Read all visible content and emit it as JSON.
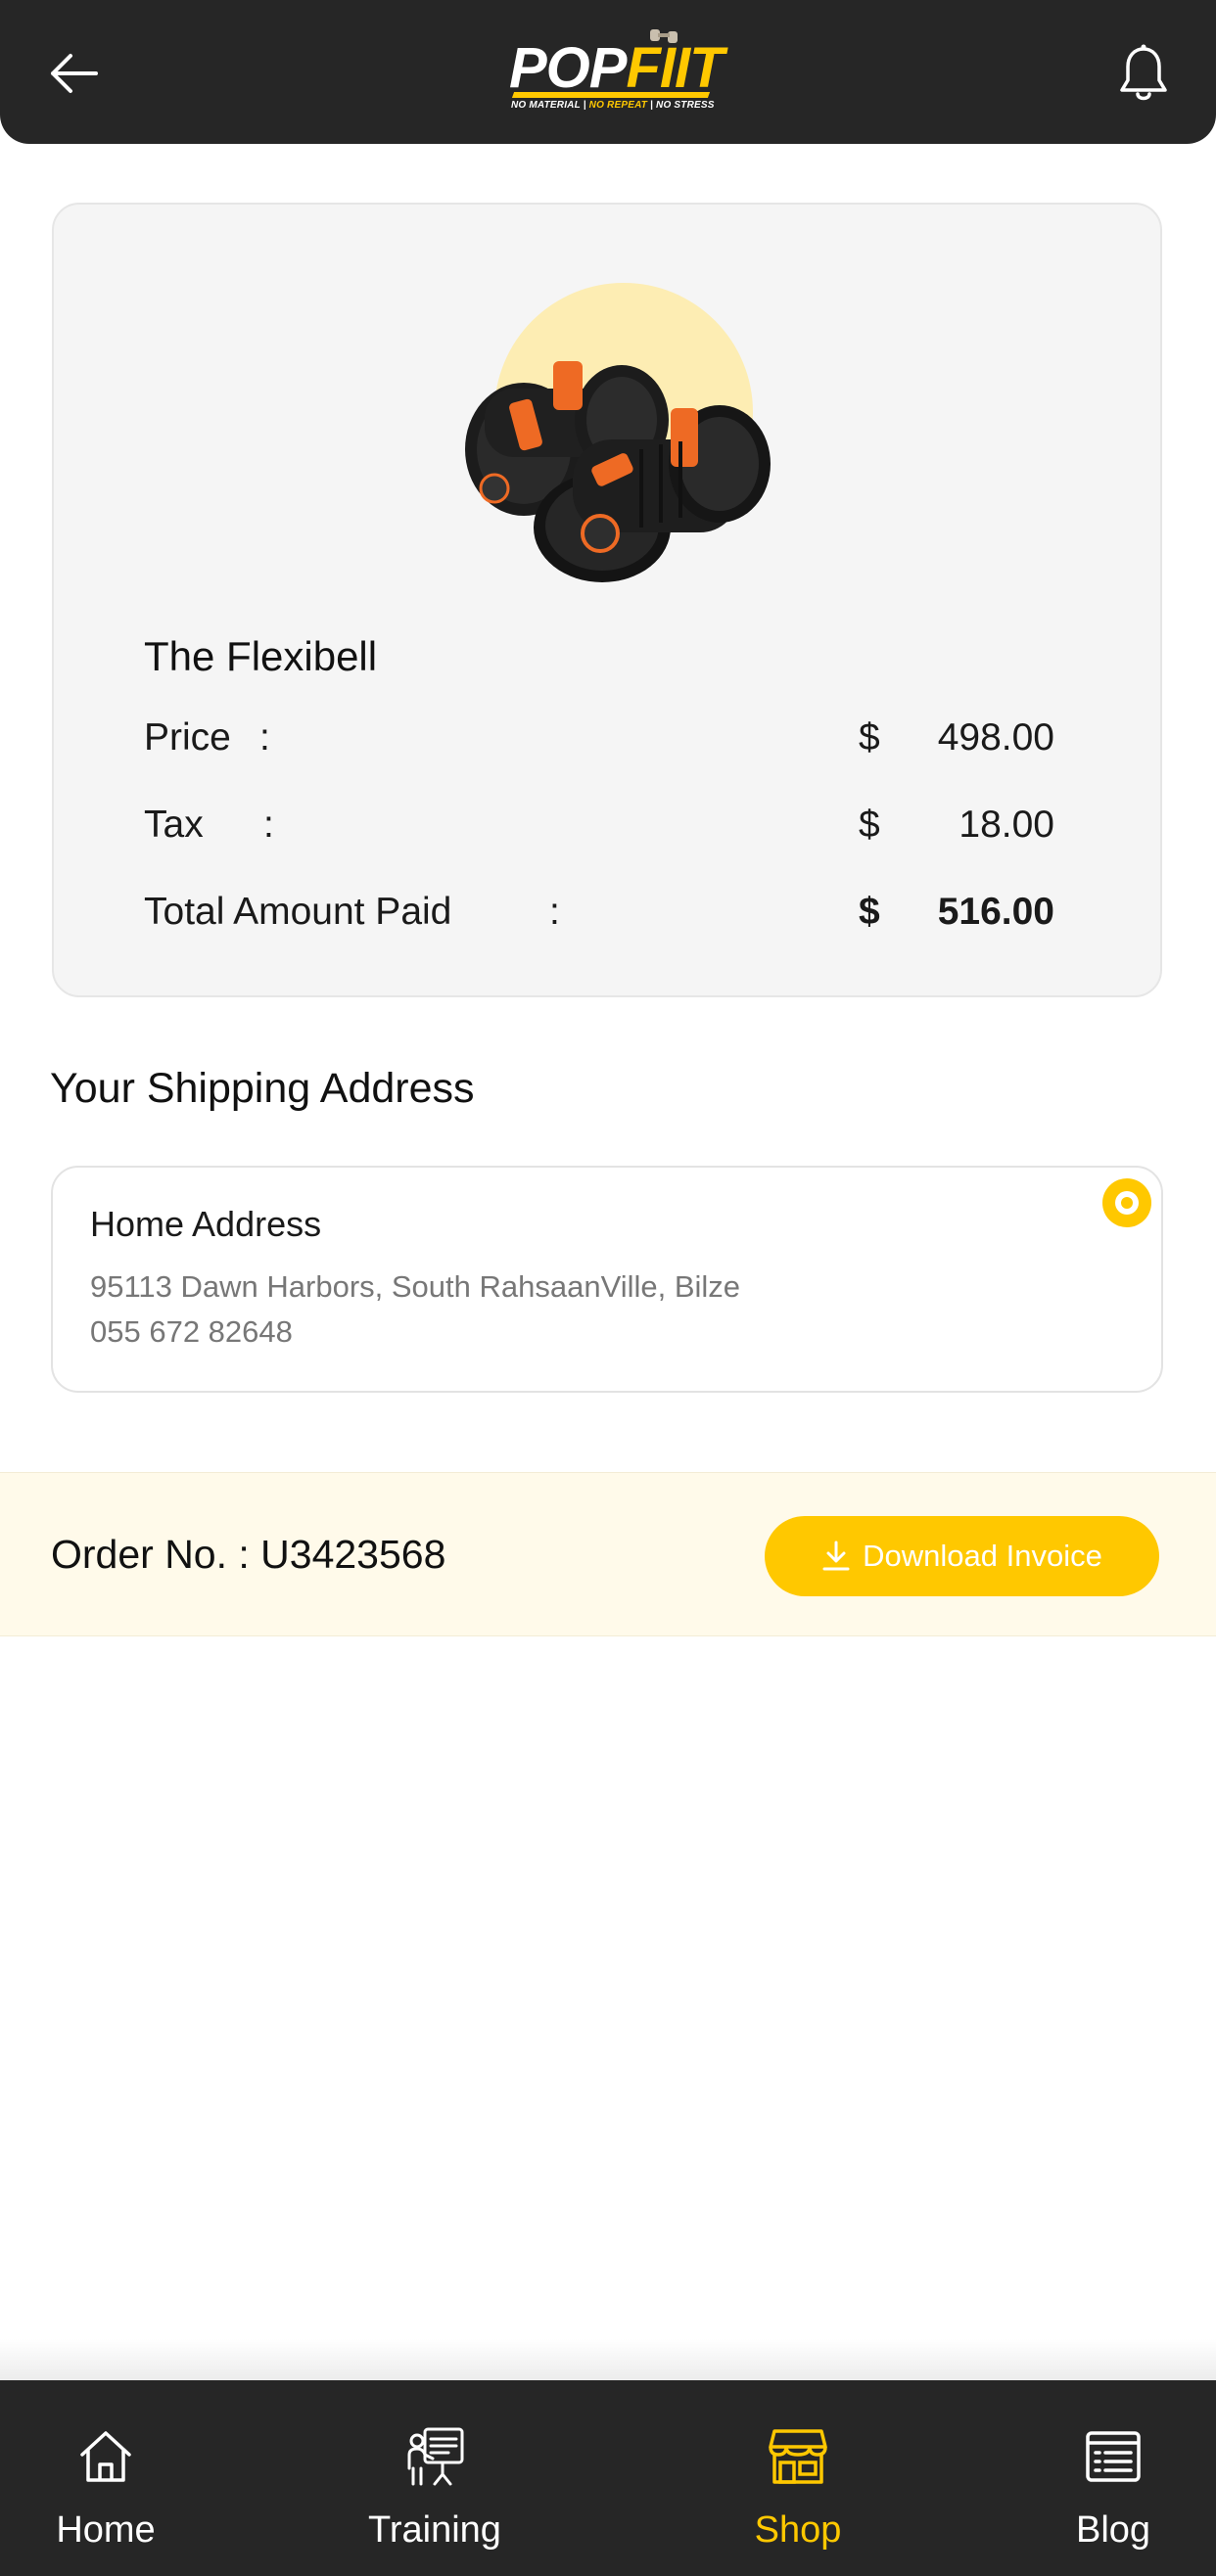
{
  "header": {
    "logo_pop": "POP",
    "logo_fiit": "FIIT",
    "logo_tag_1": "NO MATERIAL | ",
    "logo_tag_2": "NO REPEAT",
    "logo_tag_3": " | NO STRESS",
    "back_icon": "arrow-left-icon",
    "bell_icon": "bell-icon"
  },
  "product": {
    "name": "The Flexibell",
    "image_icon": "adjustable-dumbbells-image",
    "price_label": "Price",
    "price_colon": ":",
    "price_currency": "$",
    "price_value": "498.00",
    "tax_label": "Tax",
    "tax_colon": ":",
    "tax_currency": "$",
    "tax_value": "18.00",
    "total_label": "Total Amount Paid",
    "total_colon": ":",
    "total_currency": "$",
    "total_value": "516.00"
  },
  "shipping": {
    "section_title": "Your Shipping Address",
    "address_title": "Home Address",
    "address_line1": "95113 Dawn Harbors, South RahsaanVille, Bilze",
    "address_line2": "055 672 82648",
    "selected": true
  },
  "order": {
    "label": "Order No. : U3423568",
    "download_label": "Download Invoice",
    "download_icon": "download-icon"
  },
  "nav": {
    "items": [
      {
        "label": "Home",
        "icon": "home-icon",
        "active": false
      },
      {
        "label": "Training",
        "icon": "training-icon",
        "active": false
      },
      {
        "label": "Shop",
        "icon": "shop-icon",
        "active": true
      },
      {
        "label": "Blog",
        "icon": "blog-icon",
        "active": false
      }
    ]
  },
  "colors": {
    "accent": "#ffc800",
    "header_bg": "#262626",
    "card_bg": "#f5f5f5",
    "order_bar_bg": "#fffaea"
  }
}
